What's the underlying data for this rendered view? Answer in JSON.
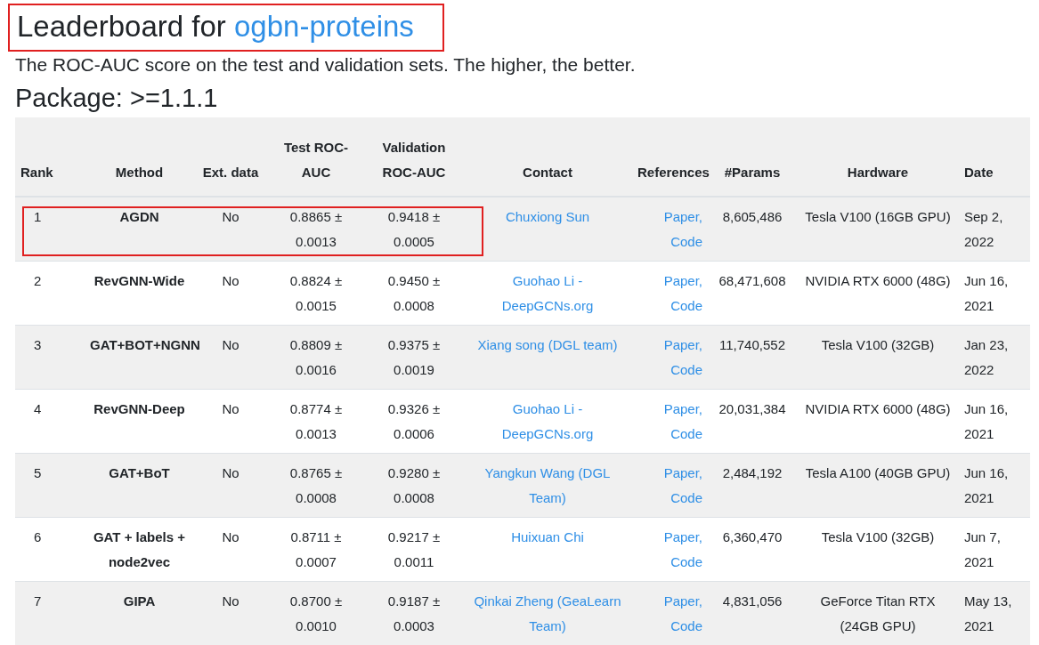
{
  "title": {
    "prefix": "Leaderboard for",
    "dataset": "ogbn-proteins",
    "highlighted": true
  },
  "description": "The ROC-AUC score on the test and validation sets. The higher, the better.",
  "package": "Package: >=1.1.1",
  "table": {
    "columns": [
      "Rank",
      "Method",
      "Ext. data",
      "Test ROC-AUC",
      "Validation ROC-AUC",
      "Contact",
      "References",
      "#Params",
      "Hardware",
      "Date"
    ],
    "rows": [
      {
        "rank": "1",
        "method": "AGDN",
        "ext_data": "No",
        "test": "0.8865 ± 0.0013",
        "validation": "0.9418 ± 0.0005",
        "contact": "Chuxiong Sun",
        "references": [
          "Paper,",
          "Code"
        ],
        "params": "8,605,486",
        "hardware": "Tesla V100 (16GB GPU)",
        "date": "Sep 2, 2022",
        "highlighted": true
      },
      {
        "rank": "2",
        "method": "RevGNN-Wide",
        "ext_data": "No",
        "test": "0.8824 ± 0.0015",
        "validation": "0.9450 ± 0.0008",
        "contact": "Guohao Li - DeepGCNs.org",
        "references": [
          "Paper,",
          "Code"
        ],
        "params": "68,471,608",
        "hardware": "NVIDIA RTX 6000 (48G)",
        "date": "Jun 16, 2021",
        "highlighted": false
      },
      {
        "rank": "3",
        "method": "GAT+BOT+NGNN",
        "ext_data": "No",
        "test": "0.8809 ± 0.0016",
        "validation": "0.9375 ± 0.0019",
        "contact": "Xiang song (DGL team)",
        "references": [
          "Paper,",
          "Code"
        ],
        "params": "11,740,552",
        "hardware": "Tesla V100 (32GB)",
        "date": "Jan 23, 2022",
        "highlighted": false
      },
      {
        "rank": "4",
        "method": "RevGNN-Deep",
        "ext_data": "No",
        "test": "0.8774 ± 0.0013",
        "validation": "0.9326 ± 0.0006",
        "contact": "Guohao Li - DeepGCNs.org",
        "references": [
          "Paper,",
          "Code"
        ],
        "params": "20,031,384",
        "hardware": "NVIDIA RTX 6000 (48G)",
        "date": "Jun 16, 2021",
        "highlighted": false
      },
      {
        "rank": "5",
        "method": "GAT+BoT",
        "ext_data": "No",
        "test": "0.8765 ± 0.0008",
        "validation": "0.9280 ± 0.0008",
        "contact": "Yangkun Wang (DGL Team)",
        "references": [
          "Paper,",
          "Code"
        ],
        "params": "2,484,192",
        "hardware": "Tesla A100 (40GB GPU)",
        "date": "Jun 16, 2021",
        "highlighted": false
      },
      {
        "rank": "6",
        "method": "GAT + labels + node2vec",
        "ext_data": "No",
        "test": "0.8711 ± 0.0007",
        "validation": "0.9217 ± 0.0011",
        "contact": "Huixuan Chi",
        "references": [
          "Paper,",
          "Code"
        ],
        "params": "6,360,470",
        "hardware": "Tesla V100 (32GB)",
        "date": "Jun 7, 2021",
        "highlighted": false
      },
      {
        "rank": "7",
        "method": "GIPA",
        "ext_data": "No",
        "test": "0.8700 ± 0.0010",
        "validation": "0.9187 ± 0.0003",
        "contact": "Qinkai Zheng (GeaLearn Team)",
        "references": [
          "Paper,",
          "Code"
        ],
        "params": "4,831,056",
        "hardware": "GeForce Titan RTX (24GB GPU)",
        "date": "May 13, 2021",
        "highlighted": false
      }
    ]
  }
}
